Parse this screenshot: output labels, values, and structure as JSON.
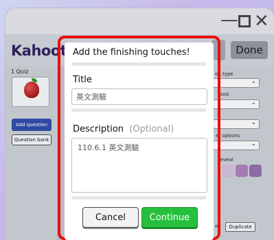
{
  "window": {
    "controls": {
      "minimize_icon": "—",
      "close_icon": "✕"
    }
  },
  "app": {
    "logo": "Kahoot",
    "done_label": "Done",
    "left_pane": {
      "quiz_count": "1 Quiz",
      "add_question_label": "Add question",
      "question_bank_label": "Question bank"
    },
    "right_pane": {
      "question_type_label": "on type",
      "time_limit_label": "limit",
      "answer_options_label": "er options",
      "image_reveal_label": "reveal",
      "duplicate_label": "Duplicate",
      "duplicate_prefix": "e"
    }
  },
  "modal": {
    "title": "Add the finishing touches!",
    "title_label": "Title",
    "title_value": "英文測驗",
    "description_label": "Description",
    "description_optional": "(Optional)",
    "description_value": "110.6.1 英文測驗",
    "cancel_label": "Cancel",
    "continue_label": "Continue"
  },
  "colors": {
    "highlight": "#e80f0f",
    "continue": "#26c03c",
    "logo": "#33205e",
    "add_question": "#2e4aa3"
  },
  "icons": [
    "minimize-icon",
    "maximize-icon",
    "close-icon",
    "apple-icon",
    "chevron-down-icon"
  ]
}
